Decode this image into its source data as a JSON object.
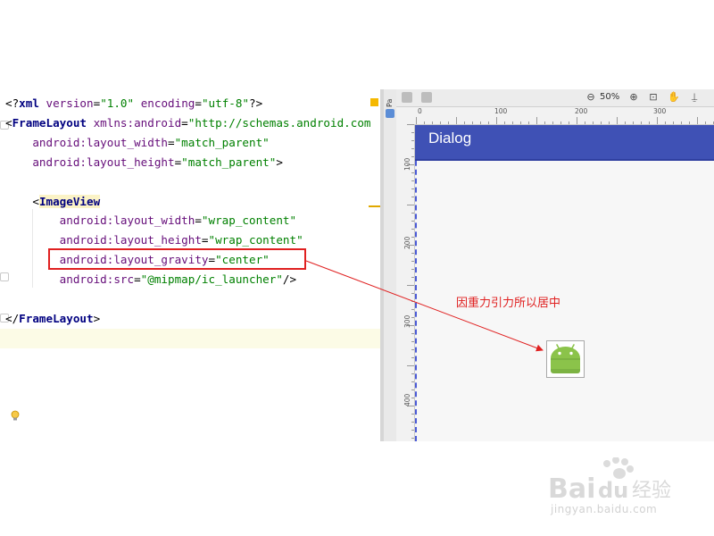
{
  "editor": {
    "lines": [
      [
        {
          "t": "<?",
          "c": "pn"
        },
        {
          "t": "xml ",
          "c": "tag"
        },
        {
          "t": "version",
          "c": "attr"
        },
        {
          "t": "=",
          "c": "pn"
        },
        {
          "t": "\"1.0\"",
          "c": "val"
        },
        {
          "t": " ",
          "c": "pn"
        },
        {
          "t": "encoding",
          "c": "attr"
        },
        {
          "t": "=",
          "c": "pn"
        },
        {
          "t": "\"utf-8\"",
          "c": "val"
        },
        {
          "t": "?>",
          "c": "pn"
        }
      ],
      [
        {
          "t": "<",
          "c": "pn"
        },
        {
          "t": "FrameLayout ",
          "c": "tag"
        },
        {
          "t": "xmlns:android",
          "c": "attr"
        },
        {
          "t": "=",
          "c": "pn"
        },
        {
          "t": "\"http://schemas.android.com",
          "c": "val"
        }
      ],
      [
        {
          "t": "    ",
          "c": "pn"
        },
        {
          "t": "android:layout_width",
          "c": "attr"
        },
        {
          "t": "=",
          "c": "pn"
        },
        {
          "t": "\"match_parent\"",
          "c": "val"
        }
      ],
      [
        {
          "t": "    ",
          "c": "pn"
        },
        {
          "t": "android:layout_height",
          "c": "attr"
        },
        {
          "t": "=",
          "c": "pn"
        },
        {
          "t": "\"match_parent\"",
          "c": "val"
        },
        {
          "t": ">",
          "c": "pn"
        }
      ],
      [],
      [
        {
          "t": "    ",
          "c": "pn"
        },
        {
          "t": "<",
          "c": "pn"
        },
        {
          "t": "ImageView",
          "c": "tag highlight-tag"
        }
      ],
      [
        {
          "t": "        ",
          "c": "pn"
        },
        {
          "t": "android:layout_width",
          "c": "attr"
        },
        {
          "t": "=",
          "c": "pn"
        },
        {
          "t": "\"wrap_content\"",
          "c": "val"
        }
      ],
      [
        {
          "t": "        ",
          "c": "pn"
        },
        {
          "t": "android:layout_height",
          "c": "attr"
        },
        {
          "t": "=",
          "c": "pn"
        },
        {
          "t": "\"wrap_content\"",
          "c": "val"
        }
      ],
      [
        {
          "t": "        ",
          "c": "pn"
        },
        {
          "t": "android:layout_gravity",
          "c": "attr"
        },
        {
          "t": "=",
          "c": "pn"
        },
        {
          "t": "\"center\"",
          "c": "val"
        }
      ],
      [
        {
          "t": "        ",
          "c": "pn"
        },
        {
          "t": "android:src",
          "c": "attr"
        },
        {
          "t": "=",
          "c": "pn"
        },
        {
          "t": "\"@mipmap/ic_launcher\"",
          "c": "val"
        },
        {
          "t": "/>",
          "c": "pn"
        }
      ],
      [],
      [
        {
          "t": "</",
          "c": "pn"
        },
        {
          "t": "FrameLayout",
          "c": "tag"
        },
        {
          "t": ">",
          "c": "pn"
        }
      ]
    ]
  },
  "preview": {
    "side_tab_label": "Pa",
    "zoom": "50%",
    "ruler_top_labels": [
      "0",
      "100",
      "200",
      "300"
    ],
    "ruler_left_labels": [
      "100",
      "200",
      "300",
      "400"
    ],
    "app_bar_title": "Dialog",
    "app_bar_color": "#3f51b5",
    "image_icon": "android-robot-icon"
  },
  "annotation": {
    "text": "因重力引力所以居中",
    "color": "#e02020"
  },
  "watermark": {
    "brand": "Baidu经验",
    "url": "jingyan.baidu.com"
  }
}
